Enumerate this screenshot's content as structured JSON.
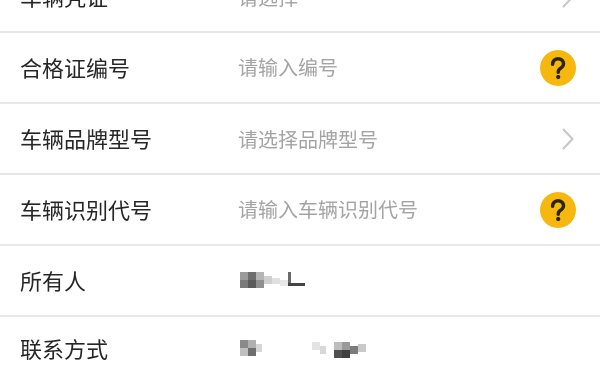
{
  "form": {
    "rows": [
      {
        "label": "车辆凭证",
        "placeholder": "请选择",
        "accessory_icon": "chevron-right-icon"
      },
      {
        "label": "合格证编号",
        "placeholder": "请输入编号",
        "accessory_icon": "help-icon"
      },
      {
        "label": "车辆品牌型号",
        "placeholder": "请选择品牌型号",
        "accessory_icon": "chevron-right-icon"
      },
      {
        "label": "车辆识别代号",
        "placeholder": "请输入车辆识别代号",
        "accessory_icon": "help-icon"
      },
      {
        "label": "所有人"
      },
      {
        "label": "联系方式"
      }
    ]
  },
  "colors": {
    "background": "#ffffff",
    "label_text": "#262626",
    "placeholder_text": "#a3a3a3",
    "divider": "#e7e7e7",
    "chevron": "#c6c6c6",
    "help_icon_fill": "#f6b80f",
    "help_icon_glyph": "#2b2400"
  }
}
